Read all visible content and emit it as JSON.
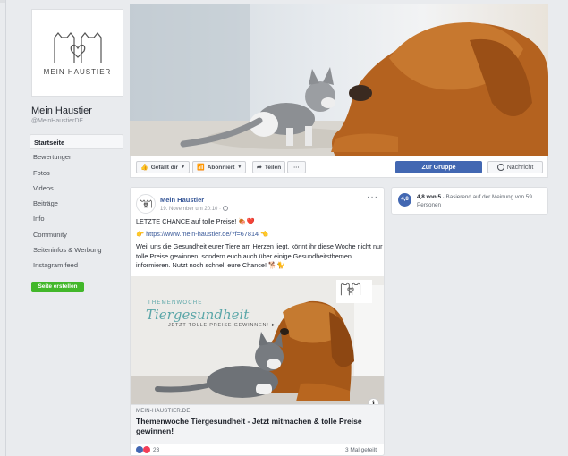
{
  "page": {
    "name": "Mein Haustier",
    "handle": "@MeinHaustierDE",
    "logo_text": "MEIN HAUSTIER"
  },
  "nav": [
    {
      "label": "Startseite",
      "active": true
    },
    {
      "label": "Bewertungen"
    },
    {
      "label": "Fotos"
    },
    {
      "label": "Videos"
    },
    {
      "label": "Beiträge"
    },
    {
      "label": "Info"
    },
    {
      "label": "Community"
    },
    {
      "label": "Seiteninfos & Werbung"
    },
    {
      "label": "Instagram feed"
    }
  ],
  "create_page_label": "Seite erstellen",
  "actions": {
    "like": "Gefällt dir",
    "subscribed": "Abonniert",
    "share": "Teilen",
    "more": "···",
    "group": "Zur Gruppe",
    "message": "Nachricht"
  },
  "post": {
    "author": "Mein Haustier",
    "time": "19. November um 20:10 · ",
    "menu": "···",
    "line1": "LETZTE CHANCE auf tolle Preise! 🍖❤️",
    "link_prefix": "👉 ",
    "link": "https://www.mein-haustier.de/?f=67814",
    "link_suffix": " 👈",
    "body": "Weil uns die Gesundheit eurer Tiere am Herzen liegt, könnt ihr diese Woche nicht nur tolle Preise gewinnen, sondern euch auch über einige Gesundheitsthemen informieren. Nutzt noch schnell eure Chance! 🐕🐈",
    "image_overlay_small": "THEMENWOCHE",
    "image_overlay_big": "Tiergesundheit",
    "image_overlay_sub": "JETZT TOLLE PREISE GEWINNEN! ►",
    "link_domain": "MEIN-HAUSTIER.DE",
    "link_title": "Themenwoche Tiergesundheit - Jetzt mitmachen & tolle Preise gewinnen!",
    "reaction_count": "23",
    "shares": "3 Mal geteilt",
    "info": "i"
  },
  "rating": {
    "score": "4,8",
    "label_bold": "4,8 von 5",
    "label_rest": " · Basierend auf der Meinung von 59 Personen"
  },
  "colors": {
    "brand_blue": "#4267b2",
    "link_blue": "#385898",
    "green": "#42b72a",
    "accent_teal": "#5aa6a8"
  }
}
